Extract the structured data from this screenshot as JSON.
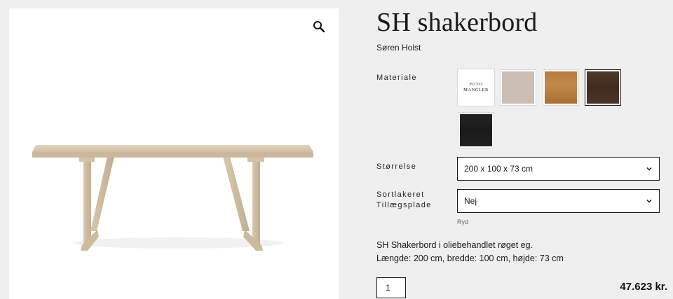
{
  "product": {
    "title": "SH shakerbord",
    "designer": "Søren Holst",
    "description_line1": "SH Shakerbord i oliebehandlet røget eg.",
    "description_line2": "Længde: 200 cm, bredde: 100 cm, højde: 73 cm",
    "price": "47.623 kr.",
    "quantity": "1"
  },
  "gallery": {
    "zoom_icon": "search-icon"
  },
  "options": {
    "material": {
      "label": "Materiale",
      "swatches": [
        {
          "name": "foto-mangler",
          "line1": "FOTO",
          "line2": "MANGLER",
          "color": "#ffffff",
          "selected": false
        },
        {
          "name": "light",
          "color": "#cbbfb3",
          "selected": false
        },
        {
          "name": "oak",
          "color": "#b7803f",
          "selected": false
        },
        {
          "name": "smoked-oak",
          "color": "#4a3426",
          "selected": true
        },
        {
          "name": "black",
          "color": "#1f1f1f",
          "selected": false
        }
      ]
    },
    "size": {
      "label": "Størrelse",
      "value": "200 x 100 x 73 cm"
    },
    "black_lacquer_leaf": {
      "label_line1": "Sortlakeret",
      "label_line2": "Tillægsplade",
      "value": "Nej"
    },
    "clear_label": "Ryd"
  },
  "colors": {
    "background": "#efefef",
    "panel": "#ffffff",
    "border": "#1a1a1a",
    "wood": "#dccbb2"
  }
}
